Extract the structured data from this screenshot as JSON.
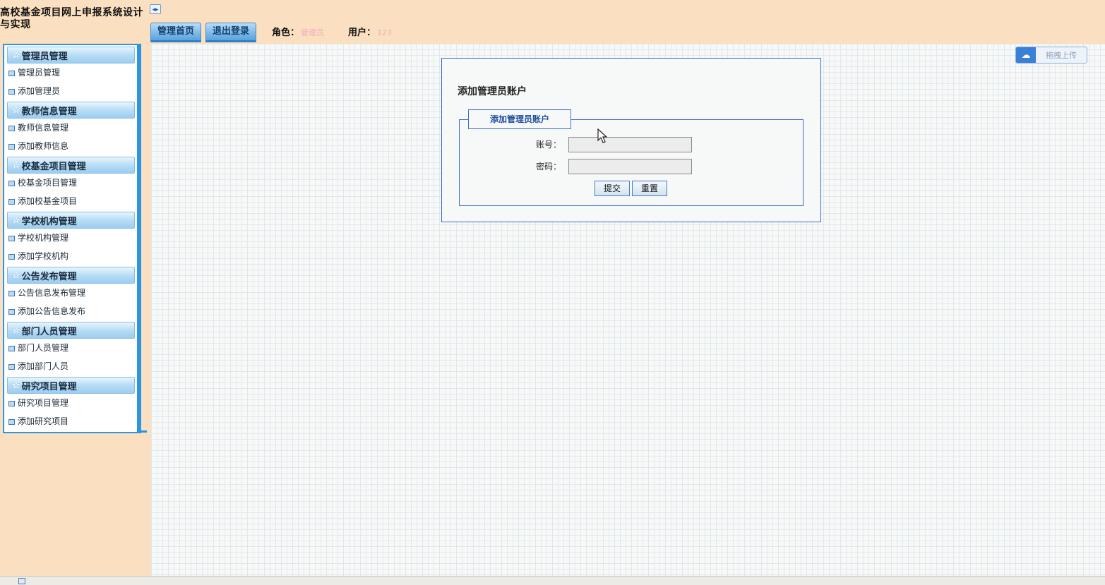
{
  "app_title": "高校基金项目网上申报系统设计与实现",
  "toggle_icon": "◂▸",
  "topbar": {
    "home_label": "管理首页",
    "logout_label": "退出登录",
    "role_label": "角色：",
    "role_value": "管理员",
    "user_label": "用户：",
    "user_value": "123"
  },
  "sidebar": {
    "groups": [
      {
        "title": "管理员管理",
        "items": [
          "管理员管理",
          "添加管理员"
        ]
      },
      {
        "title": "教师信息管理",
        "items": [
          "教师信息管理",
          "添加教师信息"
        ]
      },
      {
        "title": "校基金项目管理",
        "items": [
          "校基金项目管理",
          "添加校基金项目"
        ]
      },
      {
        "title": "学校机构管理",
        "items": [
          "学校机构管理",
          "添加学校机构"
        ]
      },
      {
        "title": "公告发布管理",
        "items": [
          "公告信息发布管理",
          "添加公告信息发布"
        ]
      },
      {
        "title": "部门人员管理",
        "items": [
          "部门人员管理",
          "添加部门人员"
        ]
      },
      {
        "title": "研究项目管理",
        "items": [
          "研究项目管理",
          "添加研究项目"
        ]
      }
    ]
  },
  "upload": {
    "label": "拖拽上传",
    "icon": "cloud-upload-icon"
  },
  "form": {
    "heading": "添加管理员账户",
    "legend": "添加管理员账户",
    "account_label": "账号：",
    "account_value": "",
    "password_label": "密码：",
    "password_value": "",
    "submit_label": "提交",
    "reset_label": "重置"
  },
  "colors": {
    "background": "#fae0c0",
    "accent": "#2a95e2",
    "role_text": "#f4a9c0"
  }
}
